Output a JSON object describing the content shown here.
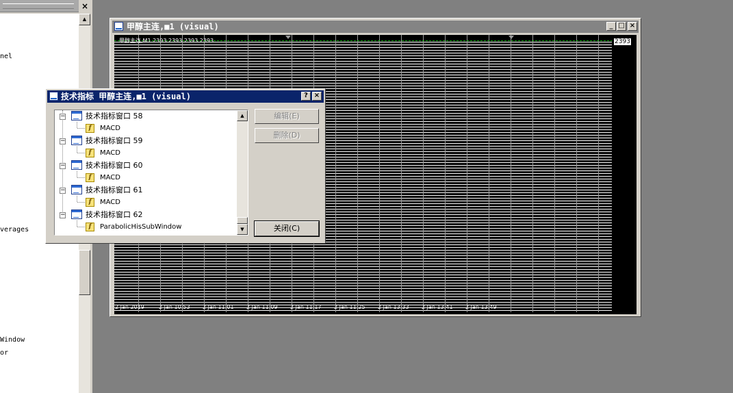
{
  "navigator": {
    "items": [
      {
        "text": "nel"
      },
      {
        "text": "verages"
      },
      {
        "text": "Window"
      },
      {
        "text": "or"
      }
    ]
  },
  "chart_window": {
    "title": "甲醇主连,■1 (visual)",
    "ohlc_text": "甲醇主连,M1  2393 2393 2393 2393",
    "price_tag": "2393",
    "time_labels": [
      "2 Jan 2019",
      "2 Jan 10:53",
      "2 Jan 11:01",
      "2 Jan 11:09",
      "2 Jan 11:17",
      "2 Jan 11:25",
      "2 Jan 13:33",
      "2 Jan 13:41",
      "2 Jan 13:49"
    ],
    "colors": {
      "background": "#000000",
      "grid": "#ffffff",
      "price_line": "#00c000"
    }
  },
  "dialog": {
    "title": "技术指标 甲醇主连,■1 (visual)",
    "help_button": "?",
    "close_x": "×",
    "tree": [
      {
        "window": "技术指标窗口 58",
        "indicator": "MACD"
      },
      {
        "window": "技术指标窗口 59",
        "indicator": "MACD"
      },
      {
        "window": "技术指标窗口 60",
        "indicator": "MACD"
      },
      {
        "window": "技术指标窗口 61",
        "indicator": "MACD"
      },
      {
        "window": "技术指标窗口 62",
        "indicator": "ParabolicHisSubWindow"
      }
    ],
    "buttons": {
      "edit": "编辑(E)",
      "delete": "删除(D)",
      "close": "关闭(C)"
    }
  }
}
